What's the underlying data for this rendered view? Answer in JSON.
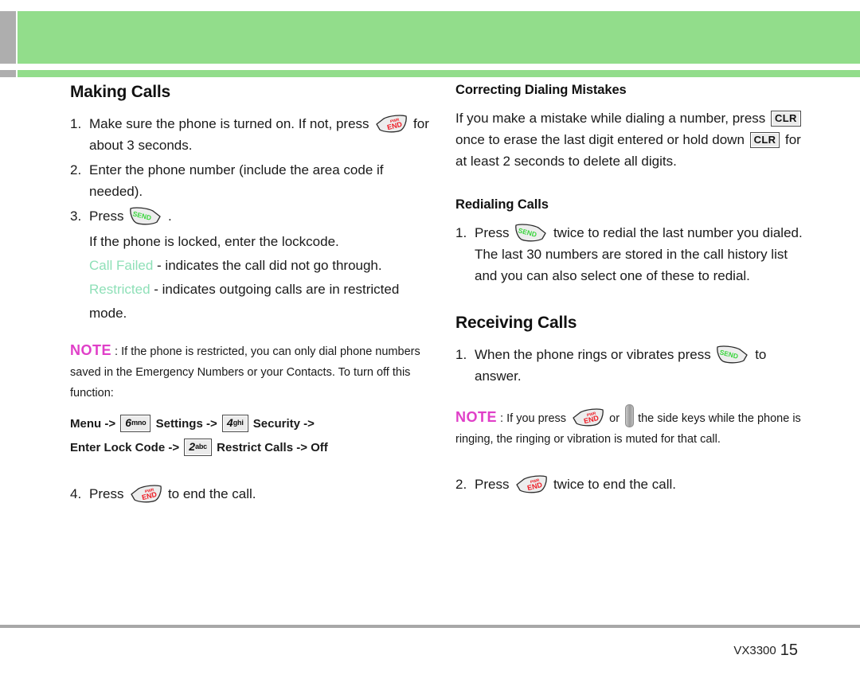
{
  "page": {
    "device_model": "VX3300",
    "page_number": "15",
    "header_color": "#92dd8b",
    "tab_color": "#aeaeae",
    "note_color": "#e03fc8",
    "status_text_color": "#8fe0b8"
  },
  "left_column": {
    "section_title": "Making Calls",
    "steps": [
      {
        "num": "1.",
        "text_before": "Make sure the phone is turned on. If not, press",
        "key": "end-key",
        "text_after": "for about 3 seconds."
      },
      {
        "num": "2.",
        "text_before": "Enter the phone number (include the area code if needed).",
        "key": "",
        "text_after": ""
      },
      {
        "num": "3.",
        "text_before": "Press",
        "key": "send-key",
        "text_after": "."
      }
    ],
    "locked_note": "If the phone is locked, enter the lockcode.",
    "status_messages": [
      {
        "status": "Call Failed",
        "description": "- indicates the call did not go through."
      },
      {
        "status": "Restricted",
        "description": "- indicates outgoing calls are in restricted mode."
      }
    ],
    "note": {
      "label": "NOTE",
      "body": ": If the phone is restricted, you can only dial phone numbers saved in the Emergency Numbers or your Contacts. To turn off this function:"
    },
    "menu_path_line1": {
      "p1": "Menu ->",
      "key1_digit": "6",
      "key1_letters": "mno",
      "p2": "Settings ->",
      "key2_digit": "4",
      "key2_letters": "ghi",
      "p3": "Security ->"
    },
    "menu_path_line2": {
      "p1": "Enter Lock Code ->",
      "key1_digit": "2",
      "key1_letters": "abc",
      "p2": "Restrict Calls -> Off"
    },
    "final_step": {
      "num": "4.",
      "text_before": "Press",
      "key": "end-key",
      "text_after": "to end the call."
    }
  },
  "right_column": {
    "correcting": {
      "title": "Correcting Dialing Mistakes",
      "t1": "If you make a mistake while dialing a number, press",
      "key1": "CLR",
      "t2": "once to erase the last digit entered or hold down",
      "key2": "CLR",
      "t3": "for at least 2 seconds to delete all digits."
    },
    "redialing": {
      "title": "Redialing Calls",
      "num": "1.",
      "t1": "Press",
      "key": "send-key",
      "t2": "twice to redial the last number you dialed. The last 30 numbers are stored in the call history list and you can also select one of these to redial."
    },
    "receiving": {
      "title": "Receiving Calls",
      "step1": {
        "num": "1.",
        "t1": "When the phone rings or vibrates press",
        "key": "send-key",
        "t2": "to answer."
      },
      "note": {
        "label": "NOTE",
        "t1": ": If you press",
        "key": "end-key",
        "t2": "or",
        "sidekey": "side-key",
        "t3": "the side keys while the phone is ringing, the ringing or vibration is muted for that call."
      },
      "step2": {
        "num": "2.",
        "t1": "Press",
        "key": "end-key",
        "t2": "twice to end the call."
      }
    }
  },
  "key_glyphs": {
    "end_label_top": "PWR",
    "end_label_bottom": "END",
    "end_label_color": "#ee1c25",
    "send_label": "SEND",
    "send_label_color": "#39d63c"
  }
}
